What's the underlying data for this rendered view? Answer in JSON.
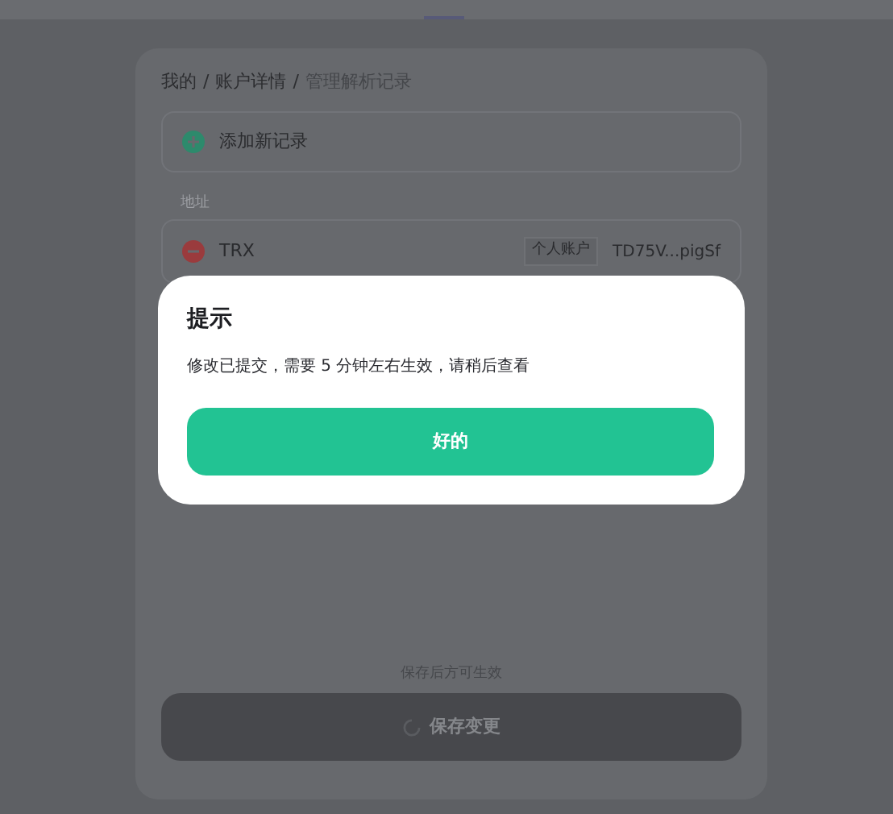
{
  "breadcrumb": [
    {
      "label": "我的"
    },
    {
      "separator": "/",
      "label": "账户详情"
    },
    {
      "separator": "/",
      "label": "管理解析记录"
    }
  ],
  "add_record": {
    "label": "添加新记录"
  },
  "section_label": "地址",
  "records": [
    {
      "name": "TRX",
      "tag": "个人账户",
      "address": "TD75V...pigSf"
    }
  ],
  "save_hint": "保存后方可生效",
  "save_button": {
    "label": "保存变更",
    "disabled": true,
    "loading": true
  },
  "dialog": {
    "title": "提示",
    "message": "修改已提交，需要 5 分钟左右生效，请稍后查看",
    "button": "好的"
  }
}
